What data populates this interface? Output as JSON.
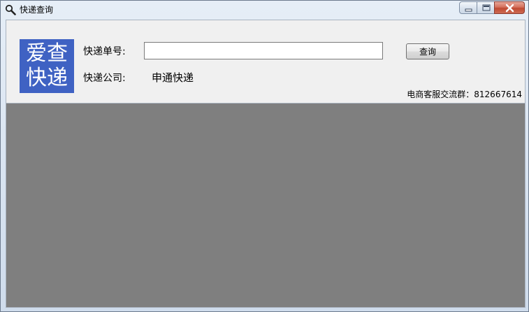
{
  "window": {
    "title": "快递查询",
    "title_icon": "magnifier-icon",
    "caption_buttons": [
      "minimize-icon",
      "maximize-icon",
      "close-icon"
    ]
  },
  "logo": {
    "line1": "爱查",
    "line2": "快递",
    "color": "#3f62c3"
  },
  "form": {
    "number_label": "快递单号:",
    "number_value": "",
    "query_button": "查询",
    "company_label": "快递公司:",
    "company_value": "申通快递"
  },
  "footer": {
    "group_info": "电商客服交流群：812667614"
  },
  "colors": {
    "content_background": "#7f7f7f",
    "panel_background": "#f0f0f0"
  }
}
